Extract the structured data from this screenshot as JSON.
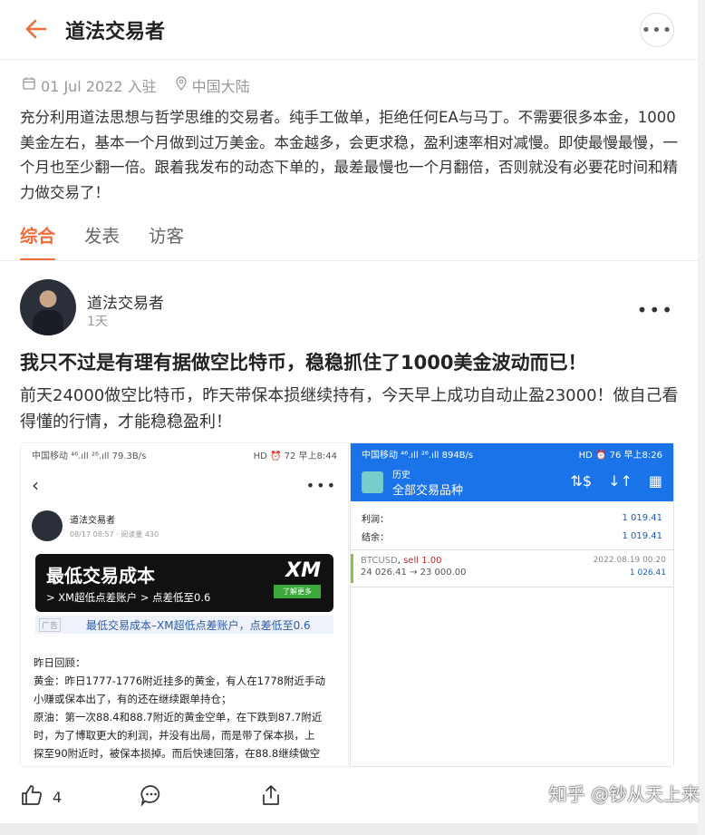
{
  "header": {
    "title": "道法交易者"
  },
  "meta": {
    "join_date": "01 Jul 2022 入驻",
    "location": "中国大陆"
  },
  "bio": "充分利用道法思想与哲学思维的交易者。纯手工做单，拒绝任何EA与马丁。不需要很多本金，1000美金左右，基本一个月做到过万美金。本金越多，会更求稳，盈利速率相对减慢。即使最慢最慢，一个月也至少翻一倍。跟着我发布的动态下单的，最差最慢也一个月翻倍，否则就没有必要花时间和精力做交易了！",
  "tabs": [
    {
      "label": "综合"
    },
    {
      "label": "发表"
    },
    {
      "label": "访客"
    }
  ],
  "post": {
    "author": "道法交易者",
    "time": "1天",
    "title": "我只不过是有理有据做空比特币，稳稳抓住了1000美金波动而已！",
    "body": "前天24000做空比特币，昨天带保本损继续持有，今天早上成功自动止盈23000！做自己看得懂的行情，才能稳稳盈利！",
    "likes": "4"
  },
  "left_image": {
    "status_left": "中国移动 ⁴⁶.ıll ²⁶.ıll 79.3B/s",
    "status_right": "HD ⏰ 72 早上8:44",
    "author": "道法交易者",
    "sub": "08/17 08:57 · 阅读量 430",
    "ad_title": "最低交易成本",
    "ad_sub": "> XM超低点差账户  > 点差低至0.6",
    "ad_brand": "XM",
    "ad_btn": "了解更多",
    "ad_tag": "广告",
    "ad_caption": "最低交易成本–XM超低点差账户，点差低至0.6",
    "recap": [
      "昨日回顾：",
      "黄金：昨日1777-1776附近挂多的黄金，有人在1778附近手动",
      "小赚或保本出了，有的还在继续跟单持仓；",
      "原油：第一次88.4和88.7附近的黄金空单，在下跌到87.7附近",
      "时，为了博取更大的利润，并没有出局，而是带了保本损，上",
      "探至90附近时，被保本损掉。而后快速回落，在88.8继续做空"
    ]
  },
  "right_image": {
    "status_left": "中国移动 ⁴⁶.ıll ²⁶.ıll 894B/s",
    "status_right": "HD ⏰ 76 早上8:26",
    "title1": "历史",
    "title2": "全部交易品种",
    "profit_label": "利润：",
    "profit_value": "1 019.41",
    "balance_label": "结余：",
    "balance_value": "1 019.41",
    "trade_symbol": "BTCUSD",
    "trade_side": "sell 1.00",
    "trade_prices": "24 026.41 → 23 000.00",
    "trade_date": "2022.08.19 00:20",
    "trade_pl": "1 026.41"
  },
  "watermark": "知乎 @钞从天上来"
}
